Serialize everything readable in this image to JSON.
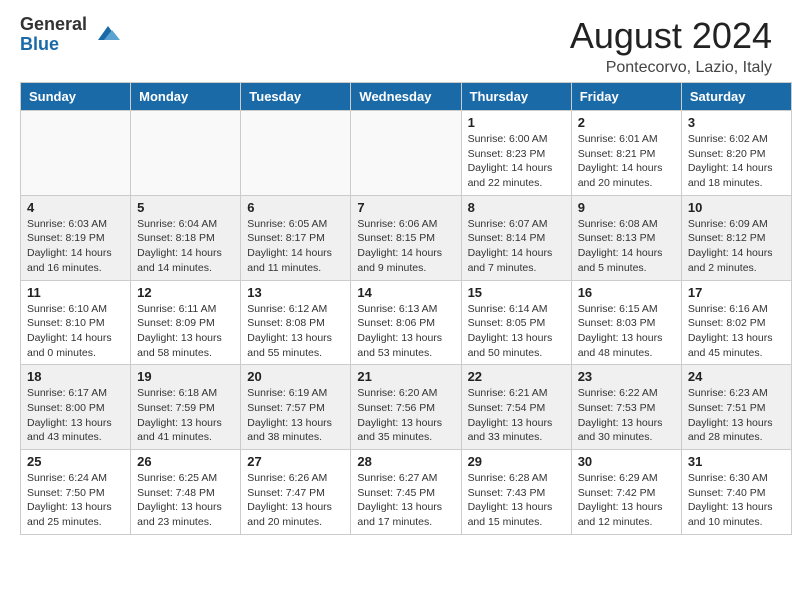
{
  "header": {
    "logo_general": "General",
    "logo_blue": "Blue",
    "month_year": "August 2024",
    "location": "Pontecorvo, Lazio, Italy"
  },
  "days_of_week": [
    "Sunday",
    "Monday",
    "Tuesday",
    "Wednesday",
    "Thursday",
    "Friday",
    "Saturday"
  ],
  "weeks": [
    [
      {
        "day": "",
        "info": "",
        "empty": true
      },
      {
        "day": "",
        "info": "",
        "empty": true
      },
      {
        "day": "",
        "info": "",
        "empty": true
      },
      {
        "day": "",
        "info": "",
        "empty": true
      },
      {
        "day": "1",
        "info": "Sunrise: 6:00 AM\nSunset: 8:23 PM\nDaylight: 14 hours\nand 22 minutes.",
        "empty": false
      },
      {
        "day": "2",
        "info": "Sunrise: 6:01 AM\nSunset: 8:21 PM\nDaylight: 14 hours\nand 20 minutes.",
        "empty": false
      },
      {
        "day": "3",
        "info": "Sunrise: 6:02 AM\nSunset: 8:20 PM\nDaylight: 14 hours\nand 18 minutes.",
        "empty": false
      }
    ],
    [
      {
        "day": "4",
        "info": "Sunrise: 6:03 AM\nSunset: 8:19 PM\nDaylight: 14 hours\nand 16 minutes.",
        "empty": false
      },
      {
        "day": "5",
        "info": "Sunrise: 6:04 AM\nSunset: 8:18 PM\nDaylight: 14 hours\nand 14 minutes.",
        "empty": false
      },
      {
        "day": "6",
        "info": "Sunrise: 6:05 AM\nSunset: 8:17 PM\nDaylight: 14 hours\nand 11 minutes.",
        "empty": false
      },
      {
        "day": "7",
        "info": "Sunrise: 6:06 AM\nSunset: 8:15 PM\nDaylight: 14 hours\nand 9 minutes.",
        "empty": false
      },
      {
        "day": "8",
        "info": "Sunrise: 6:07 AM\nSunset: 8:14 PM\nDaylight: 14 hours\nand 7 minutes.",
        "empty": false
      },
      {
        "day": "9",
        "info": "Sunrise: 6:08 AM\nSunset: 8:13 PM\nDaylight: 14 hours\nand 5 minutes.",
        "empty": false
      },
      {
        "day": "10",
        "info": "Sunrise: 6:09 AM\nSunset: 8:12 PM\nDaylight: 14 hours\nand 2 minutes.",
        "empty": false
      }
    ],
    [
      {
        "day": "11",
        "info": "Sunrise: 6:10 AM\nSunset: 8:10 PM\nDaylight: 14 hours\nand 0 minutes.",
        "empty": false
      },
      {
        "day": "12",
        "info": "Sunrise: 6:11 AM\nSunset: 8:09 PM\nDaylight: 13 hours\nand 58 minutes.",
        "empty": false
      },
      {
        "day": "13",
        "info": "Sunrise: 6:12 AM\nSunset: 8:08 PM\nDaylight: 13 hours\nand 55 minutes.",
        "empty": false
      },
      {
        "day": "14",
        "info": "Sunrise: 6:13 AM\nSunset: 8:06 PM\nDaylight: 13 hours\nand 53 minutes.",
        "empty": false
      },
      {
        "day": "15",
        "info": "Sunrise: 6:14 AM\nSunset: 8:05 PM\nDaylight: 13 hours\nand 50 minutes.",
        "empty": false
      },
      {
        "day": "16",
        "info": "Sunrise: 6:15 AM\nSunset: 8:03 PM\nDaylight: 13 hours\nand 48 minutes.",
        "empty": false
      },
      {
        "day": "17",
        "info": "Sunrise: 6:16 AM\nSunset: 8:02 PM\nDaylight: 13 hours\nand 45 minutes.",
        "empty": false
      }
    ],
    [
      {
        "day": "18",
        "info": "Sunrise: 6:17 AM\nSunset: 8:00 PM\nDaylight: 13 hours\nand 43 minutes.",
        "empty": false
      },
      {
        "day": "19",
        "info": "Sunrise: 6:18 AM\nSunset: 7:59 PM\nDaylight: 13 hours\nand 41 minutes.",
        "empty": false
      },
      {
        "day": "20",
        "info": "Sunrise: 6:19 AM\nSunset: 7:57 PM\nDaylight: 13 hours\nand 38 minutes.",
        "empty": false
      },
      {
        "day": "21",
        "info": "Sunrise: 6:20 AM\nSunset: 7:56 PM\nDaylight: 13 hours\nand 35 minutes.",
        "empty": false
      },
      {
        "day": "22",
        "info": "Sunrise: 6:21 AM\nSunset: 7:54 PM\nDaylight: 13 hours\nand 33 minutes.",
        "empty": false
      },
      {
        "day": "23",
        "info": "Sunrise: 6:22 AM\nSunset: 7:53 PM\nDaylight: 13 hours\nand 30 minutes.",
        "empty": false
      },
      {
        "day": "24",
        "info": "Sunrise: 6:23 AM\nSunset: 7:51 PM\nDaylight: 13 hours\nand 28 minutes.",
        "empty": false
      }
    ],
    [
      {
        "day": "25",
        "info": "Sunrise: 6:24 AM\nSunset: 7:50 PM\nDaylight: 13 hours\nand 25 minutes.",
        "empty": false
      },
      {
        "day": "26",
        "info": "Sunrise: 6:25 AM\nSunset: 7:48 PM\nDaylight: 13 hours\nand 23 minutes.",
        "empty": false
      },
      {
        "day": "27",
        "info": "Sunrise: 6:26 AM\nSunset: 7:47 PM\nDaylight: 13 hours\nand 20 minutes.",
        "empty": false
      },
      {
        "day": "28",
        "info": "Sunrise: 6:27 AM\nSunset: 7:45 PM\nDaylight: 13 hours\nand 17 minutes.",
        "empty": false
      },
      {
        "day": "29",
        "info": "Sunrise: 6:28 AM\nSunset: 7:43 PM\nDaylight: 13 hours\nand 15 minutes.",
        "empty": false
      },
      {
        "day": "30",
        "info": "Sunrise: 6:29 AM\nSunset: 7:42 PM\nDaylight: 13 hours\nand 12 minutes.",
        "empty": false
      },
      {
        "day": "31",
        "info": "Sunrise: 6:30 AM\nSunset: 7:40 PM\nDaylight: 13 hours\nand 10 minutes.",
        "empty": false
      }
    ]
  ]
}
